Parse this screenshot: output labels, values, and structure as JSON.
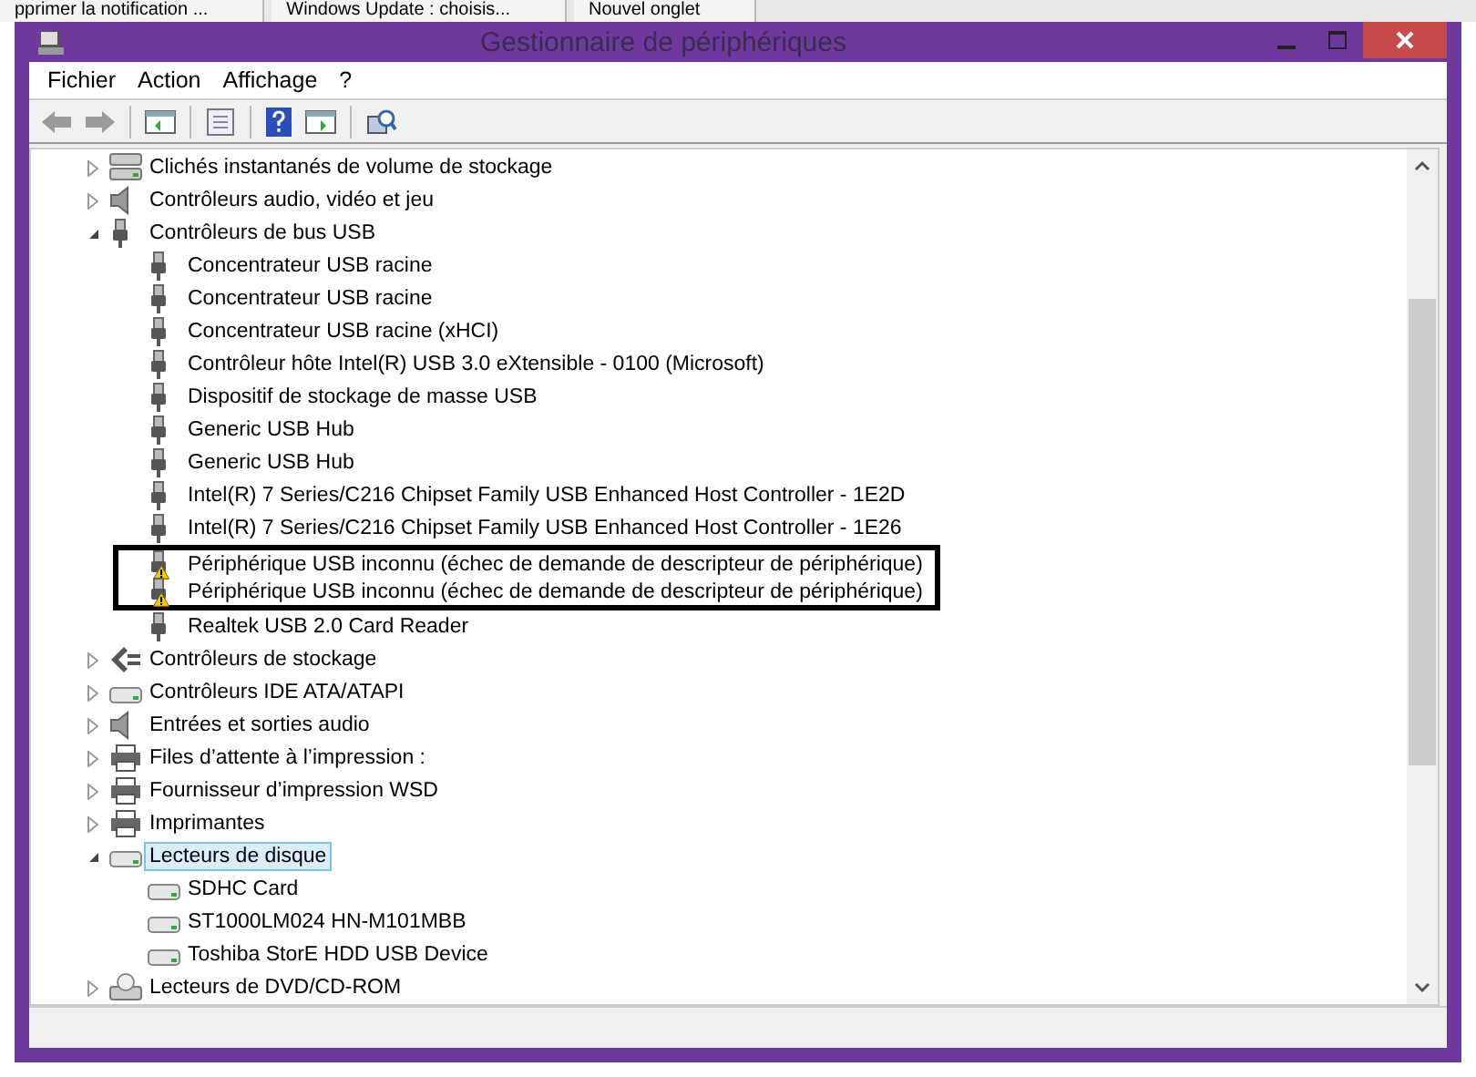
{
  "browser_tabs": [
    {
      "label": "pprimer la notification ..."
    },
    {
      "label": "Windows Update : choisis..."
    },
    {
      "label": "Nouvel onglet"
    }
  ],
  "window": {
    "title": "Gestionnaire de périphériques"
  },
  "menu": [
    "Fichier",
    "Action",
    "Affichage",
    "?"
  ],
  "tree": [
    {
      "label": "Clichés instantanés de volume de stockage",
      "kind": "volume",
      "expanded": false,
      "selected": false
    },
    {
      "label": "Contrôleurs audio, vidéo et jeu",
      "kind": "speaker",
      "expanded": false,
      "selected": false
    },
    {
      "label": "Contrôleurs de bus USB",
      "kind": "usb",
      "expanded": true,
      "selected": false,
      "children": [
        {
          "label": "Concentrateur USB racine",
          "kind": "usb",
          "warning": false,
          "outlined": false
        },
        {
          "label": "Concentrateur USB racine",
          "kind": "usb",
          "warning": false,
          "outlined": false
        },
        {
          "label": "Concentrateur USB racine (xHCI)",
          "kind": "usb",
          "warning": false,
          "outlined": false
        },
        {
          "label": "Contrôleur hôte Intel(R) USB 3.0 eXtensible - 0100 (Microsoft)",
          "kind": "usb",
          "warning": false,
          "outlined": false
        },
        {
          "label": "Dispositif de stockage de masse USB",
          "kind": "usb",
          "warning": false,
          "outlined": false
        },
        {
          "label": "Generic USB Hub",
          "kind": "usb",
          "warning": false,
          "outlined": false
        },
        {
          "label": "Generic USB Hub",
          "kind": "usb",
          "warning": false,
          "outlined": false
        },
        {
          "label": "Intel(R) 7 Series/C216 Chipset Family USB Enhanced Host Controller - 1E2D",
          "kind": "usb",
          "warning": false,
          "outlined": false
        },
        {
          "label": "Intel(R) 7 Series/C216 Chipset Family USB Enhanced Host Controller - 1E26",
          "kind": "usb",
          "warning": false,
          "outlined": false
        },
        {
          "label": "Périphérique USB inconnu (échec de demande de descripteur de périphérique)",
          "kind": "usb",
          "warning": true,
          "outlined": true
        },
        {
          "label": "Périphérique USB inconnu (échec de demande de descripteur de périphérique)",
          "kind": "usb",
          "warning": true,
          "outlined": true
        },
        {
          "label": "Realtek USB 2.0 Card Reader",
          "kind": "usb",
          "warning": false,
          "outlined": false
        }
      ]
    },
    {
      "label": "Contrôleurs de stockage",
      "kind": "storage",
      "expanded": false,
      "selected": false
    },
    {
      "label": "Contrôleurs IDE ATA/ATAPI",
      "kind": "drive",
      "expanded": false,
      "selected": false
    },
    {
      "label": "Entrées et sorties audio",
      "kind": "speaker",
      "expanded": false,
      "selected": false
    },
    {
      "label": "Files d’attente à l’impression :",
      "kind": "printer",
      "expanded": false,
      "selected": false
    },
    {
      "label": "Fournisseur d’impression WSD",
      "kind": "printer",
      "expanded": false,
      "selected": false
    },
    {
      "label": "Imprimantes",
      "kind": "printer",
      "expanded": false,
      "selected": false
    },
    {
      "label": "Lecteurs de disque",
      "kind": "drive",
      "expanded": true,
      "selected": true,
      "children": [
        {
          "label": "SDHC Card",
          "kind": "drive",
          "warning": false,
          "outlined": false
        },
        {
          "label": "ST1000LM024 HN-M101MBB",
          "kind": "drive",
          "warning": false,
          "outlined": false
        },
        {
          "label": "Toshiba StorE HDD USB Device",
          "kind": "drive",
          "warning": false,
          "outlined": false
        }
      ]
    },
    {
      "label": "Lecteurs de DVD/CD-ROM",
      "kind": "disc",
      "expanded": false,
      "selected": false
    }
  ]
}
